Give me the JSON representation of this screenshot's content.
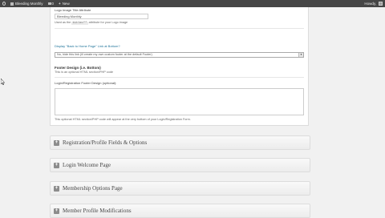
{
  "adminbar": {
    "site_name": "Bleeding Monthly",
    "comments_count": "0",
    "new_label": "New",
    "howdy": "Howdy,"
  },
  "panel": {
    "logo_title_label": "Logo Image Title Attribute",
    "logo_title_value": "Bleeding Monthly",
    "logo_title_hint_pre": "Used as the",
    "logo_title_hint_code": "title=\"\"",
    "logo_title_hint_post": "attribute for your Logo image",
    "display_link_label": "Display \"Back to Home Page\" Link at Bottom?",
    "display_link_value": "No, hide this link (ill create my own custom footer at the default Footer)",
    "footer_design_heading": "Footer Design (i.e. Bottom)",
    "footer_design_hint": "This is an optional HTML section/PHP code",
    "login_footer_label": "Login/Registration Footer Design (optional):",
    "login_footer_hint": "This optional HTML section/PHP code will appear at the very bottom of your Login/Registration Form."
  },
  "postboxes": [
    {
      "title": "Registration/Profile Fields & Options"
    },
    {
      "title": "Login Welcome Page"
    },
    {
      "title": "Membership Options Page"
    },
    {
      "title": "Member Profile Modifications"
    }
  ]
}
